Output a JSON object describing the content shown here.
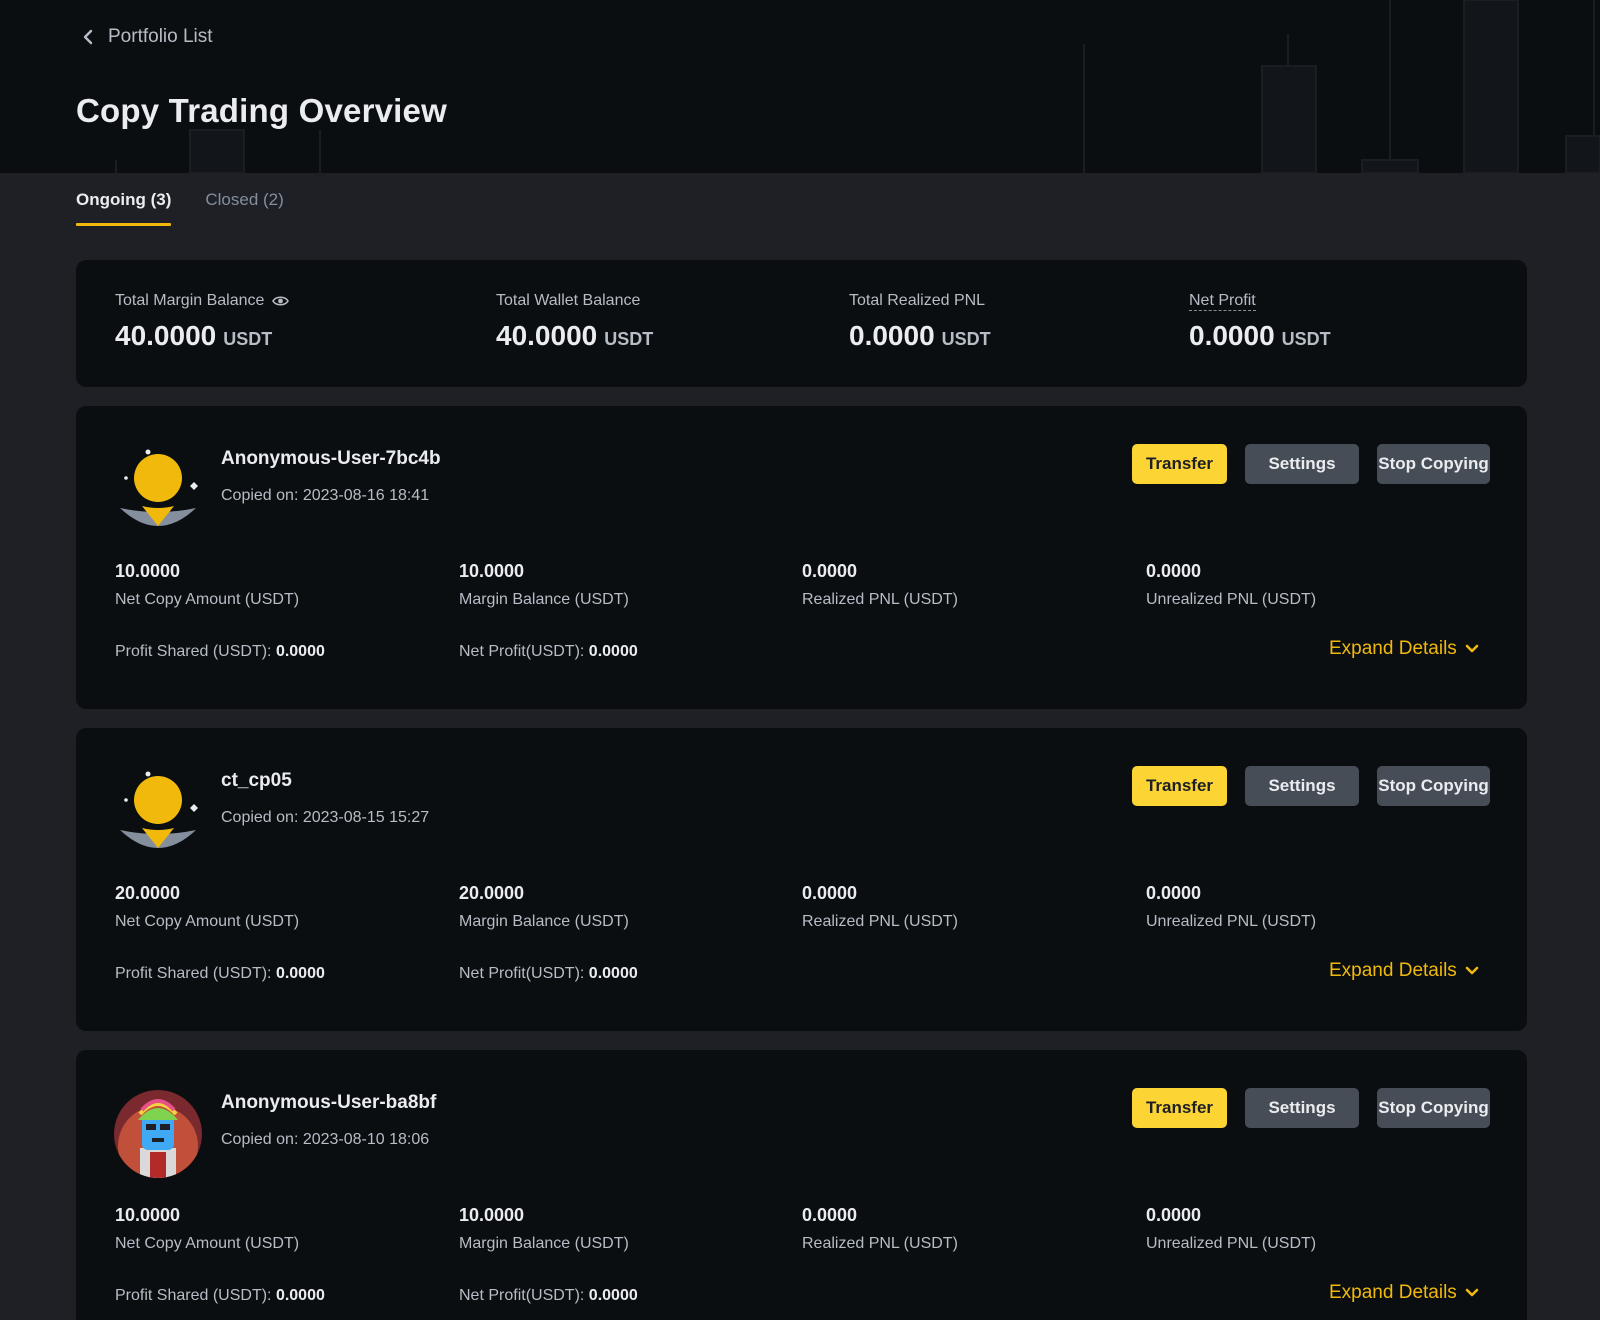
{
  "header": {
    "back_label": "Portfolio List",
    "title": "Copy Trading Overview"
  },
  "tabs": [
    {
      "label": "Ongoing (3)",
      "active": true
    },
    {
      "label": "Closed (2)",
      "active": false
    }
  ],
  "summary": {
    "total_margin_balance": {
      "label": "Total Margin Balance",
      "value": "40.0000",
      "unit": "USDT"
    },
    "total_wallet_balance": {
      "label": "Total Wallet Balance",
      "value": "40.0000",
      "unit": "USDT"
    },
    "total_realized_pnl": {
      "label": "Total Realized PNL",
      "value": "0.0000",
      "unit": "USDT"
    },
    "net_profit": {
      "label": "Net Profit",
      "value": "0.0000",
      "unit": "USDT"
    }
  },
  "buttons": {
    "transfer": "Transfer",
    "settings": "Settings",
    "stop": "Stop Copying",
    "expand": "Expand Details"
  },
  "labels": {
    "net_copy_amount": "Net Copy Amount (USDT)",
    "margin_balance": "Margin Balance (USDT)",
    "realized_pnl": "Realized PNL (USDT)",
    "unrealized_pnl": "Unrealized PNL (USDT)",
    "profit_shared": "Profit Shared (USDT):",
    "net_profit": "Net Profit(USDT):"
  },
  "portfolios": [
    {
      "name": "Anonymous-User-7bc4b",
      "copied_on": "Copied on: 2023-08-16 18:41",
      "avatar": "default-sun-icon",
      "net_copy_amount": "10.0000",
      "margin_balance": "10.0000",
      "realized_pnl": "0.0000",
      "unrealized_pnl": "0.0000",
      "profit_shared": "0.0000",
      "net_profit": "0.0000"
    },
    {
      "name": "ct_cp05",
      "copied_on": "Copied on: 2023-08-15 15:27",
      "avatar": "default-sun-icon",
      "net_copy_amount": "20.0000",
      "margin_balance": "20.0000",
      "realized_pnl": "0.0000",
      "unrealized_pnl": "0.0000",
      "profit_shared": "0.0000",
      "net_profit": "0.0000"
    },
    {
      "name": "Anonymous-User-ba8bf",
      "copied_on": "Copied on: 2023-08-10 18:06",
      "avatar": "character-avatar",
      "net_copy_amount": "10.0000",
      "margin_balance": "10.0000",
      "realized_pnl": "0.0000",
      "unrealized_pnl": "0.0000",
      "profit_shared": "0.0000",
      "net_profit": "0.0000"
    }
  ],
  "colors": {
    "accent": "#f0b90b",
    "button_primary": "#fcd535",
    "button_secondary": "#474d57",
    "page_bg": "#1e2026",
    "card_bg": "#0b0e11"
  }
}
